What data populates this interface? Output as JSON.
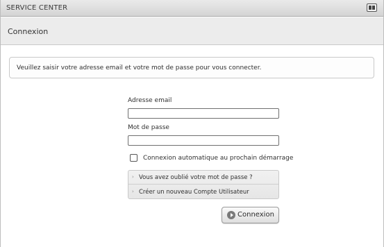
{
  "window": {
    "title": "SERVICE CENTER",
    "window_button_icon": "book-icon"
  },
  "section": {
    "title": "Connexion"
  },
  "info": {
    "message": "Veuillez saisir votre adresse email et votre mot de passe pour vous connecter."
  },
  "form": {
    "email_label": "Adresse email",
    "email_value": "",
    "password_label": "Mot de passe",
    "password_value": "",
    "auto_login_label": "Connexion automatique au prochain démarrage",
    "auto_login_checked": false,
    "links": [
      {
        "label": "Vous avez oublié votre mot de passe ?",
        "icon": "chevron-right-icon"
      },
      {
        "label": "Créer un nouveau Compte Utilisateur",
        "icon": "chevron-right-icon"
      }
    ],
    "submit_label": "Connexion",
    "submit_icon": "play-circle-icon"
  }
}
